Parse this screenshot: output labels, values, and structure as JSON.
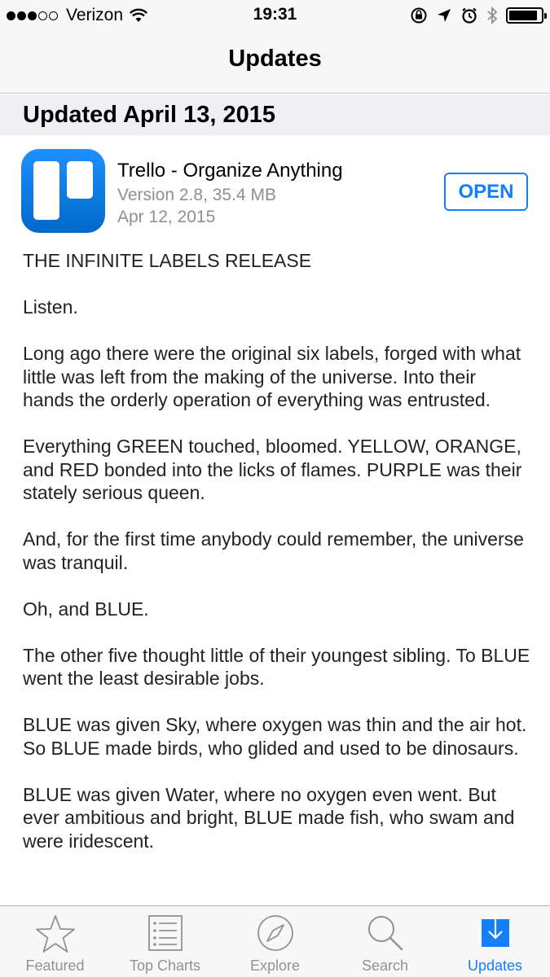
{
  "status_bar": {
    "carrier": "Verizon",
    "time": "19:31",
    "signal_strength": 3,
    "battery_level": 0.9
  },
  "nav": {
    "title": "Updates"
  },
  "section": {
    "header": "Updated April 13, 2015"
  },
  "app": {
    "name": "Trello - Organize Anything",
    "version_size": "Version 2.8, 35.4 MB",
    "date": "Apr 12, 2015",
    "action_label": "OPEN",
    "icon": "trello-icon"
  },
  "release_notes": [
    "THE INFINITE LABELS RELEASE",
    "Listen.",
    "Long ago there were the original six labels, forged with what little was left from the making of the universe. Into their hands the orderly operation of everything was entrusted.",
    "Everything GREEN touched, bloomed. YELLOW, ORANGE, and RED bonded into the licks of flames. PURPLE was their stately serious queen.",
    "And, for the first time anybody could remember, the universe was tranquil.",
    "Oh, and BLUE.",
    "The other five thought little of their youngest sibling. To BLUE went the least desirable jobs.",
    "BLUE was given Sky, where oxygen was thin and the air hot. So BLUE made birds, who glided and used to be dinosaurs.",
    "BLUE was given Water, where no oxygen even went. But ever ambitious and bright, BLUE made fish, who swam and were iridescent."
  ],
  "tabbar": {
    "tabs": [
      {
        "label": "Featured",
        "icon": "star-icon"
      },
      {
        "label": "Top Charts",
        "icon": "list-icon"
      },
      {
        "label": "Explore",
        "icon": "compass-icon"
      },
      {
        "label": "Search",
        "icon": "search-icon"
      },
      {
        "label": "Updates",
        "icon": "download-icon"
      }
    ],
    "active_index": 4
  },
  "colors": {
    "accent": "#147efb",
    "inactive": "#929292",
    "trello_blue": "#0079d3"
  }
}
